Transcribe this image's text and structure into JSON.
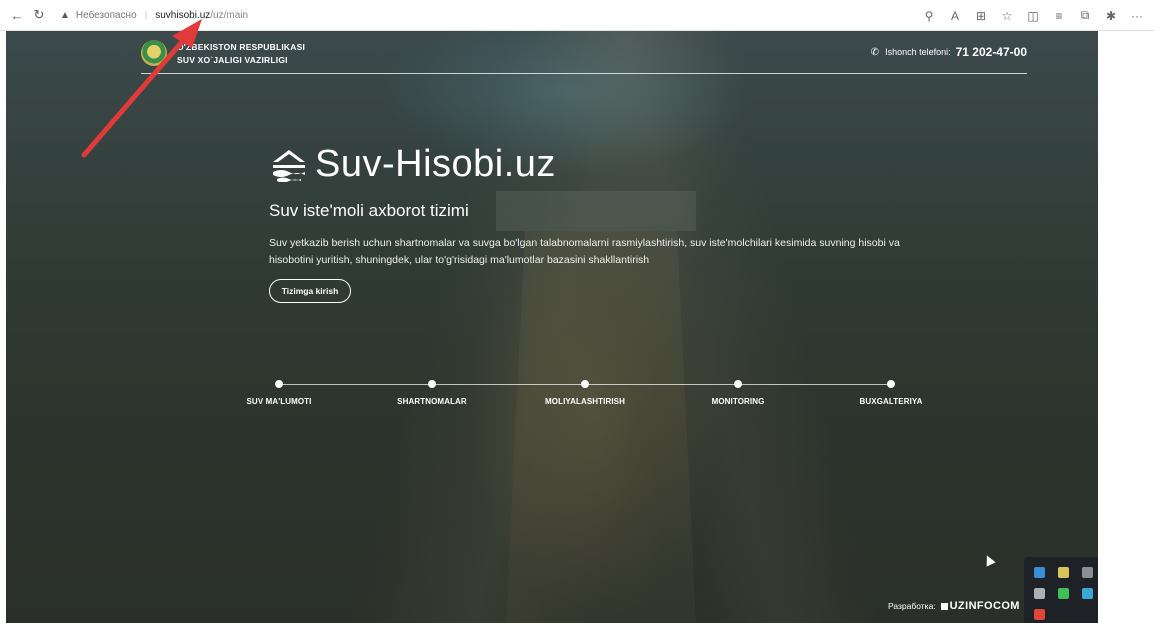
{
  "browser": {
    "insecure_label": "Небезопасно",
    "url_domain": "suvhisobi.uz",
    "url_path": "/uz/main",
    "more": "···"
  },
  "header": {
    "ministry_line1": "O'ZBEKISTON RESPUBLIKASI",
    "ministry_line2": "SUV XO`JALIGI VAZIRLIGI",
    "hotline_label": "Ishonch telefoni:",
    "hotline_number": "71 202-47-00"
  },
  "hero": {
    "brand": "Suv-Hisobi.uz",
    "subtitle": "Suv iste'moli axborot tizimi",
    "description": "Suv yetkazib berish uchun shartnomalar va suvga bo'lgan talabnomalarni rasmiylashtirish, suv iste'molchilari kesimida suvning hisobi va hisobotini yuritish, shuningdek, ular to'g'risidagi ma'lumotlar bazasini shakllantirish",
    "login_button": "Tizimga kirish"
  },
  "steps": [
    {
      "label": "SUV MA'LUMOTI"
    },
    {
      "label": "SHARTNOMALAR"
    },
    {
      "label": "MOLIYALASHTIRISH"
    },
    {
      "label": "MONITORING"
    },
    {
      "label": "BUXGALTERIYA"
    }
  ],
  "footer": {
    "developer_label": "Разработка:",
    "developer_company": "UZINFOCOM"
  },
  "colors": {
    "arrow": "#e03a3a",
    "overlay": "#2e362f",
    "text": "#ffffff"
  },
  "icons": [
    "back-icon",
    "refresh-icon",
    "warning-icon",
    "zoom-icon",
    "read-aloud-icon",
    "apps-icon",
    "favorite-icon",
    "split-screen-icon",
    "favorites-bar-icon",
    "collections-icon",
    "extensions-icon",
    "phone-icon",
    "water-logo-icon",
    "emblem-icon"
  ]
}
